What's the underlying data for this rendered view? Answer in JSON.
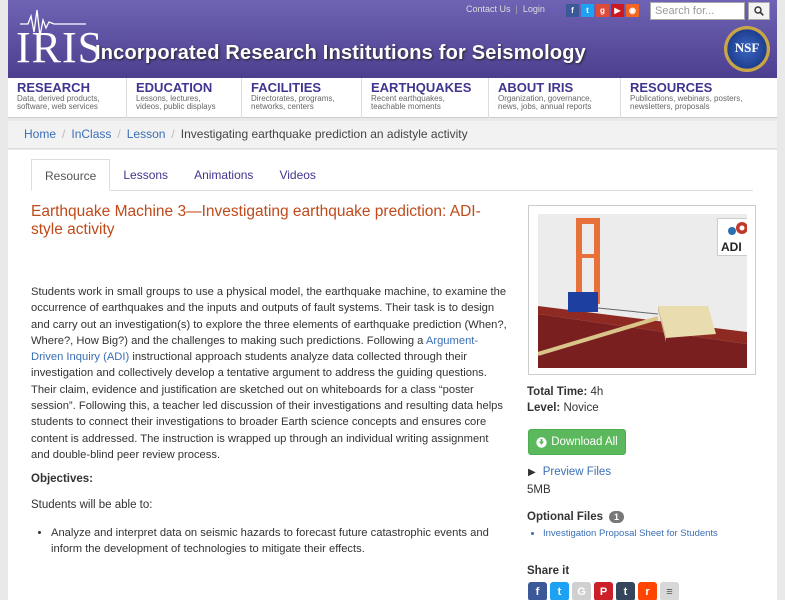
{
  "header": {
    "logo_text": "IRIS",
    "org_title": "Incorporated Research Institutions for Seismology",
    "contact_link": "Contact Us",
    "login_link": "Login",
    "search_placeholder": "Search for...",
    "nsf_logo_text": "NSF",
    "colors": {
      "header_top": "#6e63b4",
      "header_bottom": "#4d3f8f"
    }
  },
  "nav": [
    {
      "title": "RESEARCH",
      "sub1": "Data, derived products,",
      "sub2": "software, web services"
    },
    {
      "title": "EDUCATION",
      "sub1": "Lessons, lectures,",
      "sub2": "videos, public displays"
    },
    {
      "title": "FACILITIES",
      "sub1": "Directorates, programs,",
      "sub2": "networks, centers"
    },
    {
      "title": "EARTHQUAKES",
      "sub1": "Recent earthquakes,",
      "sub2": "teachable moments"
    },
    {
      "title": "ABOUT IRIS",
      "sub1": "Organization, governance,",
      "sub2": "news, jobs, annual reports"
    },
    {
      "title": "RESOURCES",
      "sub1": "Publications, webinars, posters,",
      "sub2": "newsletters, proposals"
    }
  ],
  "breadcrumb": {
    "home": "Home",
    "inclass": "InClass",
    "lesson": "Lesson",
    "current": "Investigating earthquake prediction an adistyle activity"
  },
  "tabs": [
    "Resource",
    "Lessons",
    "Animations",
    "Videos"
  ],
  "content": {
    "title": "Earthquake Machine 3—Investigating earthquake prediction: ADI-style activity",
    "desc_before_link": "Students work in small groups to use a physical model, the earthquake machine, to examine the occurrence of earthquakes and the inputs and outputs of fault systems. Their task is to design and carry out an investigation(s) to explore the three elements of earthquake prediction (When?, Where?, How Big?) and the challenges to making such predictions.  Following a ",
    "desc_link": "Argument-Driven Inquiry (ADI)",
    "desc_after_link": " instructional approach students analyze data collected through their investigation and collectively develop a tentative argument to address the guiding questions. Their claim, evidence and justification are sketched out on whiteboards for a class “poster session”. Following this, a teacher led discussion of their investigations and resulting data helps students to connect their investigations to broader Earth science concepts and ensures core content is addressed. The instruction is wrapped up through an individual writing assignment and double-blind peer review process.",
    "objectives_heading": "Objectives:",
    "objectives_intro": "Students will be able to:",
    "objectives": [
      "Analyze and interpret data on seismic hazards to forecast future catastrophic events and inform the development of technologies to mitigate their effects."
    ]
  },
  "sidebar": {
    "total_time_label": "Total Time:",
    "total_time_value": "4h",
    "level_label": "Level:",
    "level_value": "Novice",
    "download_label": "Download All",
    "preview_label": "Preview Files",
    "file_size": "5MB",
    "optional_files_label": "Optional Files",
    "optional_files_count": "1",
    "optional_files": [
      "Investigation Proposal Sheet for Students"
    ],
    "share_label": "Share it",
    "adi_badge": "ADI"
  },
  "social_icons": [
    "facebook-icon",
    "twitter-icon",
    "google-plus-icon",
    "youtube-icon",
    "rss-icon"
  ],
  "share_icons": [
    "facebook-icon",
    "twitter-icon",
    "google-plus-icon",
    "pinterest-icon",
    "tumblr-icon",
    "reddit-icon",
    "more-icon"
  ]
}
